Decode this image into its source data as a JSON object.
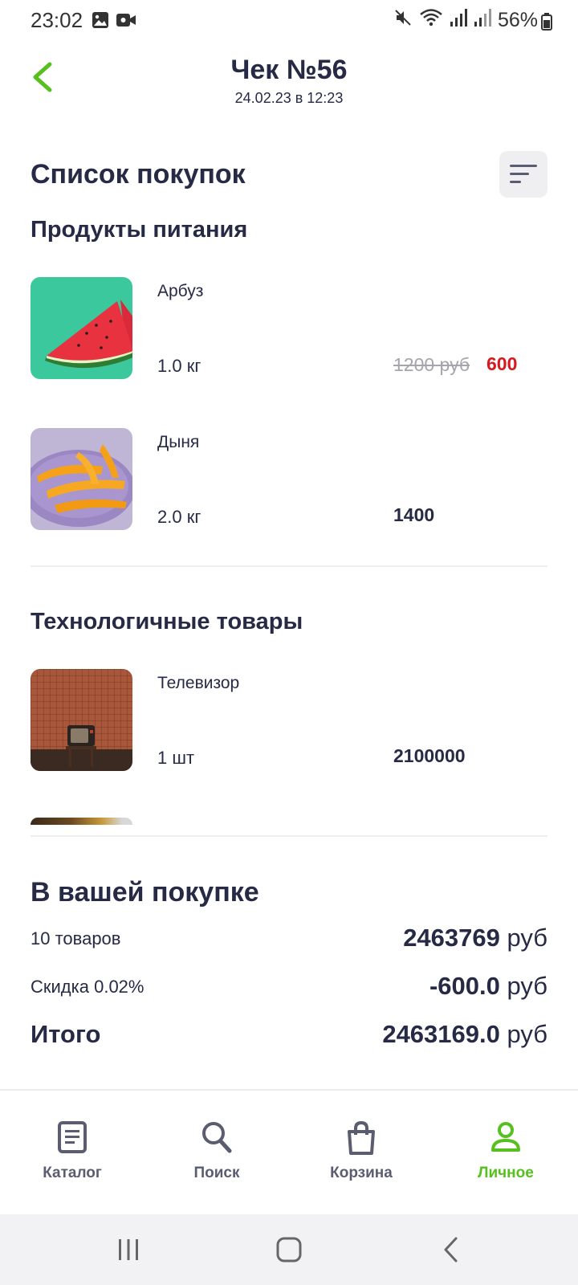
{
  "status_bar": {
    "time": "23:02",
    "battery": "56%"
  },
  "header": {
    "title": "Чек №56",
    "subtitle": "24.02.23 в 12:23"
  },
  "list": {
    "title": "Список покупок",
    "categories": [
      {
        "title": "Продукты питания",
        "items": [
          {
            "name": "Арбуз",
            "qty": "1.0 кг",
            "old_price": "1200 руб",
            "price": "600"
          },
          {
            "name": "Дыня",
            "qty": "2.0 кг",
            "price": "1400"
          }
        ]
      },
      {
        "title": "Технологичные товары",
        "items": [
          {
            "name": "Телевизор",
            "qty": "1 шт",
            "price": "2100000"
          }
        ]
      }
    ]
  },
  "summary": {
    "title": "В вашей покупке",
    "rows": [
      {
        "label": "10 товаров",
        "amount": "2463769",
        "currency": "руб"
      },
      {
        "label": "Скидка 0.02%",
        "amount": "-600.0",
        "currency": "руб"
      },
      {
        "label": "Итого",
        "amount": "2463169.0",
        "currency": "руб"
      }
    ]
  },
  "bottom_nav": {
    "items": [
      {
        "label": "Каталог",
        "icon": "catalog-icon"
      },
      {
        "label": "Поиск",
        "icon": "search-icon"
      },
      {
        "label": "Корзина",
        "icon": "cart-icon"
      },
      {
        "label": "Личное",
        "icon": "profile-icon",
        "active": true
      }
    ]
  },
  "colors": {
    "accent": "#56c01e",
    "text": "#262a45",
    "sale": "#d7181f",
    "old_price": "#a5a5ad"
  }
}
